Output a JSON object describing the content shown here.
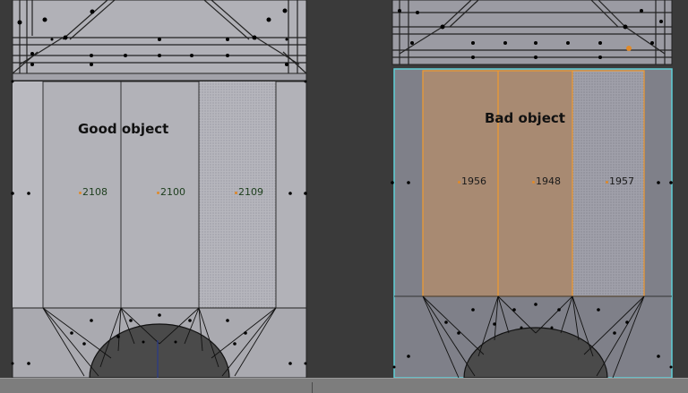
{
  "colors": {
    "background": "#3a3a3a",
    "panel": "#a9a9ae",
    "panel_dark": "#7f8089",
    "selected_face": "#a88a72",
    "selected_edge": "#f29a2e",
    "active_outline": "#5fd0d8",
    "vertex": "#000000",
    "active_vertex": "#e08a2a"
  },
  "objects": {
    "good": {
      "label": "Good object",
      "face_ids": [
        "2108",
        "2100",
        "2109"
      ]
    },
    "bad": {
      "label": "Bad object",
      "face_ids": [
        "1956",
        "1948",
        "1957"
      ]
    }
  }
}
